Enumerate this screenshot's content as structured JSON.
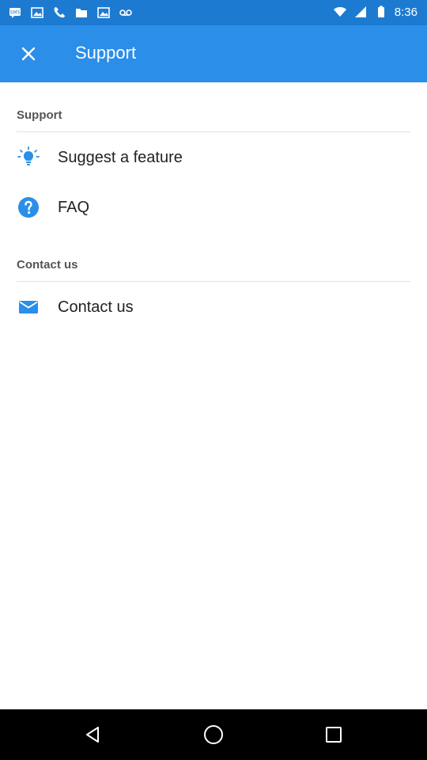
{
  "status_bar": {
    "time": "8:36",
    "left_icons": [
      "sms-icon",
      "image-icon",
      "phone-icon",
      "folder-icon",
      "image-icon",
      "voicemail-icon"
    ],
    "right_icons": [
      "wifi-icon",
      "signal-icon",
      "battery-icon"
    ]
  },
  "app_bar": {
    "title": "Support",
    "close_icon": "close-icon"
  },
  "sections": [
    {
      "header": "Support",
      "items": [
        {
          "label": "Suggest a feature",
          "icon": "lightbulb-icon"
        },
        {
          "label": "FAQ",
          "icon": "help-icon"
        }
      ]
    },
    {
      "header": "Contact us",
      "items": [
        {
          "label": "Contact us",
          "icon": "email-icon"
        }
      ]
    }
  ],
  "colors": {
    "status_bar": "#1c7bd1",
    "app_bar": "#2b8ee8",
    "accent_icon": "#2b8ee8",
    "nav_bar": "#000000"
  },
  "nav_bar": {
    "buttons": [
      "back-icon",
      "home-icon",
      "recents-icon"
    ]
  }
}
